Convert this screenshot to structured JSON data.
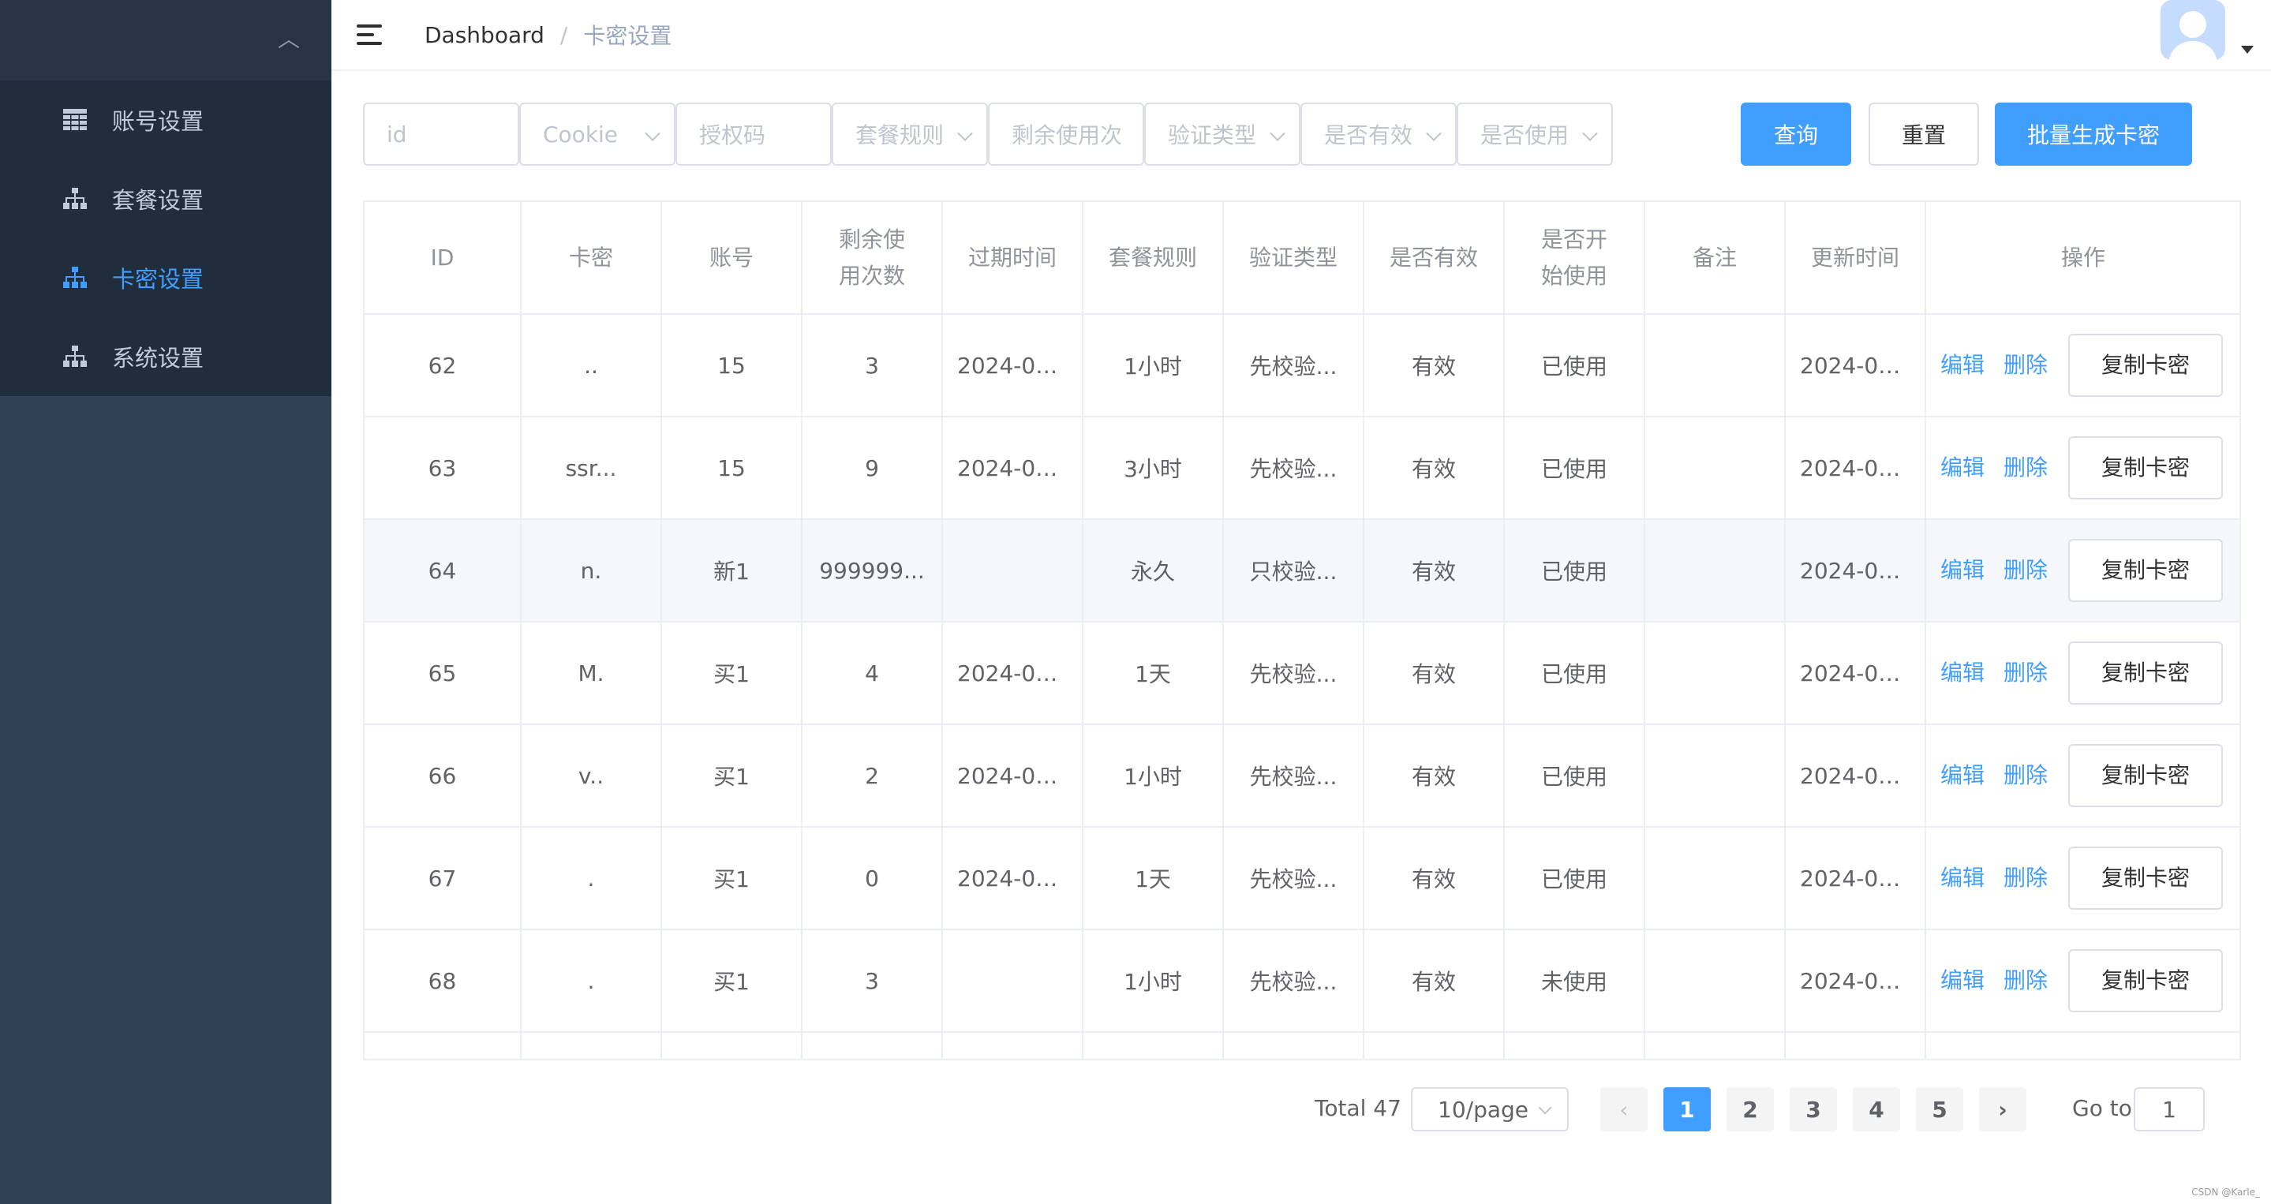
{
  "sidebar": {
    "items": [
      {
        "label": "账号设置",
        "icon": "table-icon",
        "active": false
      },
      {
        "label": "套餐设置",
        "icon": "sitemap-icon",
        "active": false
      },
      {
        "label": "卡密设置",
        "icon": "sitemap-icon",
        "active": true
      },
      {
        "label": "系统设置",
        "icon": "sitemap-icon",
        "active": false
      }
    ]
  },
  "header": {
    "breadcrumb_home": "Dashboard",
    "breadcrumb_sep": "/",
    "breadcrumb_current": "卡密设置"
  },
  "filters": {
    "id_placeholder": "id",
    "cookie_placeholder": "Cookie",
    "auth_placeholder": "授权码",
    "plan_placeholder": "套餐规则",
    "remaining_placeholder": "剩余使用次",
    "verify_placeholder": "验证类型",
    "valid_placeholder": "是否有效",
    "used_placeholder": "是否使用",
    "query_label": "查询",
    "reset_label": "重置",
    "batch_label": "批量生成卡密"
  },
  "table": {
    "headers": [
      "ID",
      "卡密",
      "账号",
      "剩余使用次数",
      "过期时间",
      "套餐规则",
      "验证类型",
      "是否有效",
      "是否开始使用",
      "备注",
      "更新时间",
      "操作"
    ],
    "edit_label": "编辑",
    "delete_label": "删除",
    "copy_label": "复制卡密",
    "rows": [
      {
        "id": "62",
        "key": "..",
        "account": "15",
        "remaining": "3",
        "expire": "2024-04...",
        "plan": "1小时",
        "verify": "先校验...",
        "valid": "有效",
        "started": "已使用",
        "note": "",
        "updated": "2024-04..."
      },
      {
        "id": "63",
        "key": "ssr...",
        "account": "15",
        "remaining": "9",
        "expire": "2024-04...",
        "plan": "3小时",
        "verify": "先校验...",
        "valid": "有效",
        "started": "已使用",
        "note": "",
        "updated": "2024-04..."
      },
      {
        "id": "64",
        "key": "n.",
        "account": "新1",
        "remaining": "999999...",
        "expire": "",
        "plan": "永久",
        "verify": "只校验...",
        "valid": "有效",
        "started": "已使用",
        "note": "",
        "updated": "2024-04..."
      },
      {
        "id": "65",
        "key": "M.",
        "account": "买1",
        "remaining": "4",
        "expire": "2024-04...",
        "plan": "1天",
        "verify": "先校验...",
        "valid": "有效",
        "started": "已使用",
        "note": "",
        "updated": "2024-04..."
      },
      {
        "id": "66",
        "key": "v..",
        "account": "买1",
        "remaining": "2",
        "expire": "2024-04...",
        "plan": "1小时",
        "verify": "先校验...",
        "valid": "有效",
        "started": "已使用",
        "note": "",
        "updated": "2024-04..."
      },
      {
        "id": "67",
        "key": ".",
        "account": "买1",
        "remaining": "0",
        "expire": "2024-04...",
        "plan": "1天",
        "verify": "先校验...",
        "valid": "有效",
        "started": "已使用",
        "note": "",
        "updated": "2024-04..."
      },
      {
        "id": "68",
        "key": ".",
        "account": "买1",
        "remaining": "3",
        "expire": "",
        "plan": "1小时",
        "verify": "先校验...",
        "valid": "有效",
        "started": "未使用",
        "note": "",
        "updated": "2024-04..."
      }
    ]
  },
  "pagination": {
    "total": "Total 47",
    "page_size": "10/page",
    "pages": [
      "1",
      "2",
      "3",
      "4",
      "5"
    ],
    "current_page": "1",
    "goto_label": "Go to",
    "goto_value": "1"
  },
  "watermark": "CSDN @Karle_",
  "colors": {
    "accent": "#409EFF",
    "sidebar_bg": "#304156",
    "menu_bg": "#1f2d3d"
  }
}
